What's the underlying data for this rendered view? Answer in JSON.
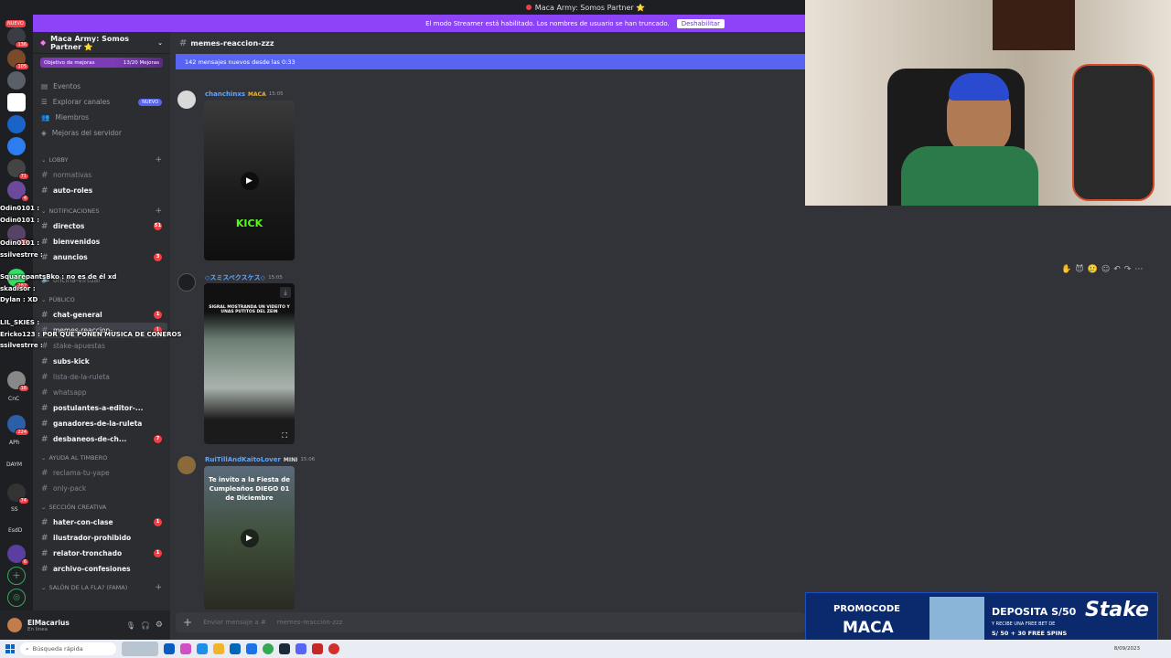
{
  "topbar": {
    "title": "Maca Army: Somos Partner ⭐"
  },
  "streamer_bar": {
    "text": "El modo Streamer está habilitado. Los nombres de usuario se han truncado.",
    "button": "Deshabilitar"
  },
  "server_rail": {
    "new_label": "NUEVO",
    "badges": [
      "136",
      "105",
      "71",
      "4",
      "30",
      "282",
      "16",
      "224",
      "74",
      "6"
    ],
    "labels": [
      "CnC",
      "APh",
      "DAYM",
      "SS",
      "EsdD"
    ]
  },
  "chat_overlay": [
    "Odin0101 :",
    "Odin0101 :",
    "Odin0101 :",
    "ssilvestrre :",
    "SquarepantsBko : no es de él xd",
    "skadisor :",
    "Dylan : XD",
    "LIL_SKIES :",
    "Ericko123 : POR QUE PONEN MUSICA DE CONEROS",
    "ssilvestrre :"
  ],
  "sidebar": {
    "server_name": "Maca Army: Somos Partner ⭐",
    "boost_goal": "Objetivo de mejoras",
    "boost_count": "13/20 Mejoras",
    "nav": [
      {
        "label": "Eventos",
        "badge": ""
      },
      {
        "label": "Explorar canales",
        "badge": "NUEVO"
      },
      {
        "label": "Miembros",
        "badge": ""
      },
      {
        "label": "Mejoras del servidor",
        "badge": ""
      }
    ],
    "categories": {
      "lobby": "LOBBY",
      "notificaciones": "NOTIFICACIONES",
      "publico": "PÚBLICO",
      "ayuda": "AYUDA AL TIMBERO",
      "creativa": "SECCIÓN CREATIVA",
      "salon": "SALÓN DE LA FLA? (FAMA)"
    },
    "channels": [
      {
        "name": "normativas",
        "count": "",
        "state": "muted"
      },
      {
        "name": "auto-roles",
        "count": "",
        "state": "unread"
      },
      {
        "name": "directos",
        "count": "51",
        "state": "unread"
      },
      {
        "name": "bienvenidos",
        "count": "",
        "state": "unread"
      },
      {
        "name": "anuncios",
        "count": "3",
        "state": "unread"
      },
      {
        "name": "oficina-virtual",
        "count": "",
        "state": "muted"
      },
      {
        "name": "chat-general",
        "count": "1",
        "state": "unread"
      },
      {
        "name": "memes-reaccion-...",
        "count": "1",
        "state": "active"
      },
      {
        "name": "stake-apuestas",
        "count": "",
        "state": "muted"
      },
      {
        "name": "subs-kick",
        "count": "",
        "state": "unread"
      },
      {
        "name": "lista-de-la-ruleta",
        "count": "",
        "state": "muted"
      },
      {
        "name": "whatsapp",
        "count": "",
        "state": "muted"
      },
      {
        "name": "postulantes-a-editor-...",
        "count": "",
        "state": "unread"
      },
      {
        "name": "ganadores-de-la-ruleta",
        "count": "",
        "state": "unread"
      },
      {
        "name": "desbaneos-de-ch...",
        "count": "7",
        "state": "unread"
      },
      {
        "name": "reclama-tu-yape",
        "count": "",
        "state": "muted"
      },
      {
        "name": "only-pack",
        "count": "",
        "state": "muted"
      },
      {
        "name": "hater-con-clase",
        "count": "1",
        "state": "unread"
      },
      {
        "name": "ilustrador-prohibido",
        "count": "",
        "state": "unread"
      },
      {
        "name": "relator-tronchado",
        "count": "1",
        "state": "unread"
      },
      {
        "name": "archivo-confesiones",
        "count": "",
        "state": "unread"
      }
    ],
    "user": {
      "name": "ElMacarius",
      "status": "En línea"
    }
  },
  "channel_header": {
    "name": "memes-reaccion-zzz"
  },
  "new_messages_bar": "142 mensajes nuevos desde las 0:33",
  "messages": [
    {
      "author": "chanchinxs",
      "tag": "MACA",
      "time": "15:05",
      "color": "#5ea6ff",
      "media_caption": "KICK"
    },
    {
      "author": "◇スミスペクスケス◇",
      "tag": "",
      "time": "15:05",
      "color": "#5ea6ff",
      "media_caption": "SIGRAL MOSTRANDA UN VIDEITO Y UNAS PUTITOS DEL ZEIN"
    },
    {
      "author": "RuiTillAndKaitoLover",
      "tag": "MINI",
      "time": "15:06",
      "color": "#5ea6ff",
      "media_caption": "Te invito a la Fiesta de Cumpleaños DIEGO 01 de Diciembre"
    }
  ],
  "composer": {
    "placeholder": "Enviar mensaje a #",
    "channel": "memes-reaccion-zzz"
  },
  "ad": {
    "promo_label": "PROMOCODE",
    "promo_code": "MACA",
    "line1": "DEPOSITA S/50",
    "line2": "Y RECIBE UNA FREE BET DE",
    "line3": "S/ 50 + 30 FREE SPINS",
    "brand": "Stake"
  },
  "taskbar": {
    "search": "Búsqueda rápida",
    "clock": "8/09/2023"
  },
  "colors": {
    "accent": "#5865f2",
    "streamer": "#8d43f7",
    "danger": "#f23f43",
    "bg": "#313338",
    "sidebar": "#2b2d31"
  }
}
